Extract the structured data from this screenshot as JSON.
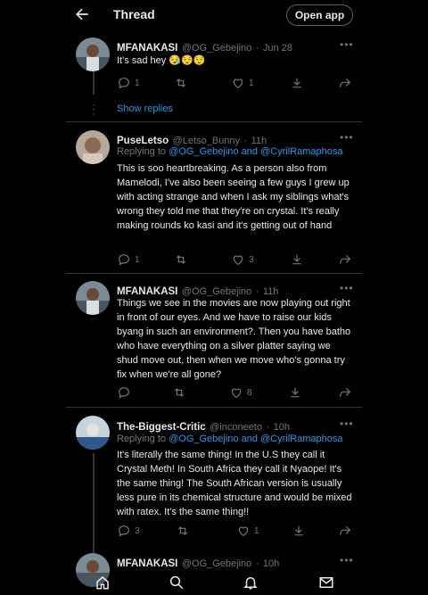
{
  "header": {
    "back_icon": "arrow-left-icon",
    "title": "Thread",
    "open_app": "Open app"
  },
  "tweets": [
    {
      "name": "MFANAKASI",
      "handle": "@OG_Gebejino",
      "sep": "·",
      "time": "Jun 28",
      "text": "It's sad hey 😪😌😌",
      "replies": "1",
      "retweets": "",
      "likes": "1"
    },
    {
      "name": "PuseLetso",
      "handle": "@Letso_Bunny",
      "sep": "·",
      "time": "11h",
      "replying_prefix": "Replying to ",
      "mention1": "@OG_Gebejino",
      "and": " and ",
      "mention2": "@CyrilRamaphosa",
      "text": "This is soo heartbreaking. As a person also from Mamelodi, I've also been seeing a few guys I grew up with acting strange and when I ask my siblings what's wrong they told me that they're on crystal. It's really making rounds ko kasi and it's getting out of hand",
      "replies": "1",
      "retweets": "",
      "likes": "3"
    },
    {
      "name": "MFANAKASI",
      "handle": "@OG_Gebejino",
      "sep": "·",
      "time": "11h",
      "text": "Things we see in the movies are now playing out right in front of our eyes. And we have to raise our kids byang in such an environment?. Then you have batho who have everything on a silver platter saying we shud move out, then when we move who's gonna try fix when we're all gone?",
      "replies": "",
      "retweets": "",
      "likes": "8"
    },
    {
      "name": "The-Biggest-Critic",
      "handle": "@inconeeto",
      "sep": "·",
      "time": "10h",
      "replying_prefix": "Replying to ",
      "mention1": "@OG_Gebejino",
      "and": " and ",
      "mention2": "@CyrilRamaphosa",
      "text": "It's literally the same thing! In the U.S they call it Crystal Meth! In South Africa they call it Nyaope! It's the same thing! The South African version is usually less pure in its chemical structure and would be mixed with ratex. It's the same thing!!",
      "replies": "3",
      "retweets": "",
      "likes": "1"
    },
    {
      "name": "MFANAKASI",
      "handle": "@OG_Gebejino",
      "sep": "·",
      "time": "10h"
    }
  ],
  "show_replies": "Show replies",
  "more_icon": "more-dots-icon",
  "tabbar": {
    "items": [
      "home-icon",
      "search-icon",
      "notifications-icon",
      "messages-icon"
    ]
  },
  "colors": {
    "accent": "#1d9bf0",
    "background": "#000000",
    "muted": "#71767b"
  }
}
